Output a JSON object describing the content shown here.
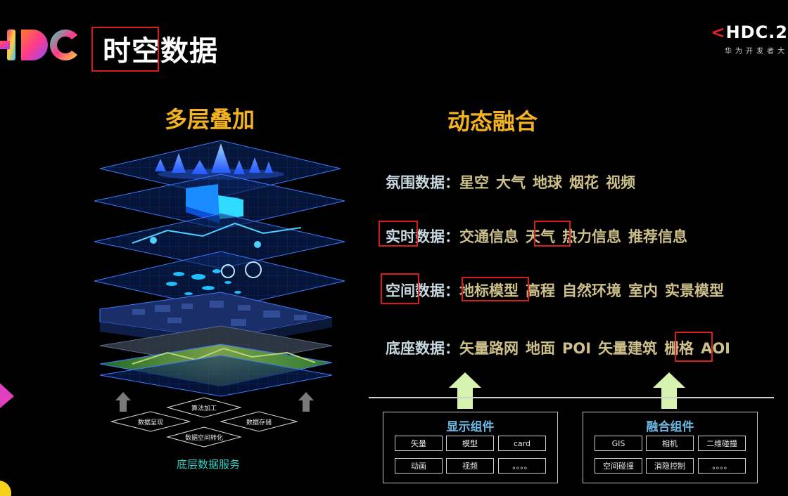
{
  "header": {
    "title": "时空数据",
    "brand": "HDC.2",
    "brand_lt": "<",
    "brand_sub": "华为开发者大"
  },
  "headings": {
    "left": "多层叠加",
    "right": "动态融合"
  },
  "stack": {
    "labels": {
      "algo": "算法加工",
      "render": "数据呈现",
      "store": "数据存储",
      "convert": "数据空间转化"
    },
    "caption": "底层数据服务"
  },
  "rows": [
    {
      "cat": "氛围数据",
      "items": [
        "星空",
        "大气",
        "地球",
        "烟花",
        "视频"
      ]
    },
    {
      "cat": "实时数据",
      "items": [
        "交通信息",
        "天气",
        "热力信息",
        "推荐信息"
      ]
    },
    {
      "cat": "空间数据",
      "items": [
        "地标模型",
        "高程",
        "自然环境",
        "室内",
        "实景模型"
      ]
    },
    {
      "cat": "底座数据",
      "items": [
        "矢量路网",
        "地面",
        "POI",
        "矢量建筑",
        "栅格",
        "AOI"
      ]
    }
  ],
  "colon": "：",
  "components": {
    "display": {
      "title": "显示组件",
      "chips": [
        "矢量",
        "模型",
        "card",
        "动画",
        "视频",
        "。。。。"
      ]
    },
    "fusion": {
      "title": "融合组件",
      "chips": [
        "GIS",
        "相机",
        "二维碰撞",
        "空间碰撞",
        "消隐控制",
        "。。。。"
      ]
    }
  },
  "colors": {
    "accent": "#f3b221",
    "highlight_box": "#d51f1f",
    "component_title": "#6db9e4",
    "arrow": "#d7f3b0"
  }
}
